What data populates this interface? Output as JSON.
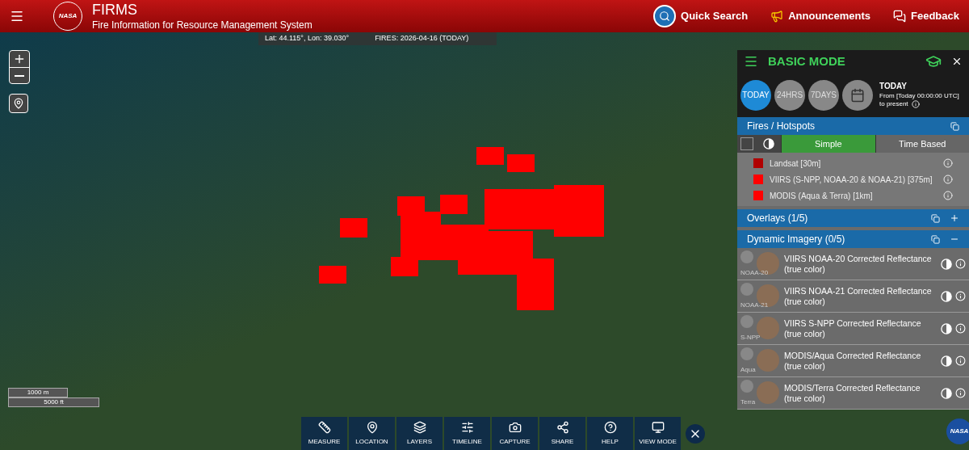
{
  "header": {
    "logo": "NASA",
    "title": "FIRMS",
    "subtitle": "Fire Information for Resource Management System",
    "links": [
      {
        "kind": "search",
        "label": "Quick Search"
      },
      {
        "kind": "announce",
        "label": "Announcements"
      },
      {
        "kind": "feedback",
        "label": "Feedback"
      }
    ]
  },
  "coords": {
    "position": "Lat: 44.115°, Lon: 39.030°",
    "fires": "FIRES: 2026-04-16 (TODAY)"
  },
  "corner_logo": "NASA",
  "scale": {
    "metric": "1000 m",
    "imperial": "5000 ft"
  },
  "panel": {
    "mode": "BASIC MODE",
    "periods": [
      {
        "label": "TODAY",
        "selected": true
      },
      {
        "label": "24HRS",
        "selected": false
      },
      {
        "label": "7DAYS",
        "selected": false
      }
    ],
    "period_title": "TODAY",
    "period_desc": "From [Today 00:00:00 UTC]",
    "period_desc2": "to present",
    "fires": {
      "title": "Fires / Hotspots",
      "checked": false,
      "modes": [
        {
          "label": "Simple",
          "selected": true
        },
        {
          "label": "Time Based",
          "selected": false
        }
      ],
      "legend": [
        {
          "label": "Landsat [30m]",
          "color": "#b00000"
        },
        {
          "label": "VIIRS (S-NPP, NOAA-20 & NOAA-21) [375m]",
          "color": "#ff0000"
        },
        {
          "label": "MODIS (Aqua & Terra) [1km]",
          "color": "#ff0000"
        }
      ]
    },
    "sections": [
      {
        "title": "Overlays (1/5)",
        "expanded": false
      },
      {
        "title": "Dynamic Imagery (0/5)",
        "expanded": true
      }
    ],
    "imagery": [
      {
        "thumb_label": "NOAA-20",
        "label": "VIIRS NOAA-20 Corrected Reflectance (true color)",
        "checked": false
      },
      {
        "thumb_label": "NOAA-21",
        "label": "VIIRS NOAA-21 Corrected Reflectance (true color)",
        "checked": false
      },
      {
        "thumb_label": "S-NPP",
        "label": "VIIRS S-NPP Corrected Reflectance (true color)",
        "checked": false
      },
      {
        "thumb_label": "Aqua",
        "label": "MODIS/Aqua Corrected Reflectance (true color)",
        "checked": false
      },
      {
        "thumb_label": "Terra",
        "label": "MODIS/Terra Corrected Reflectance (true color)",
        "checked": false
      }
    ]
  },
  "toolbar": [
    {
      "kind": "measure",
      "label": "MEASURE"
    },
    {
      "kind": "location",
      "label": "LOCATION"
    },
    {
      "kind": "layers",
      "label": "LAYERS"
    },
    {
      "kind": "timeline",
      "label": "TIMELINE"
    },
    {
      "kind": "capture",
      "label": "CAPTURE"
    },
    {
      "kind": "share",
      "label": "SHARE"
    },
    {
      "kind": "help",
      "label": "HELP"
    },
    {
      "kind": "viewmode",
      "label": "VIEW MODE"
    }
  ]
}
